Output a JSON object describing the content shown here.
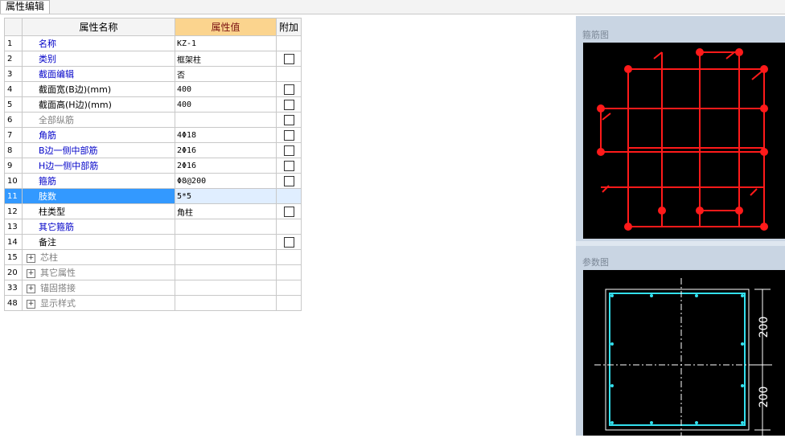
{
  "tab": {
    "label": "属性编辑"
  },
  "grid": {
    "headers": {
      "name": "属性名称",
      "value": "属性值",
      "extra": "附加"
    },
    "rows": [
      {
        "num": "1",
        "name": "名称",
        "value": "KZ-1",
        "color": "blue",
        "checkbox": false,
        "expand": false
      },
      {
        "num": "2",
        "name": "类别",
        "value": "框架柱",
        "color": "blue",
        "checkbox": true,
        "expand": false
      },
      {
        "num": "3",
        "name": "截面编辑",
        "value": "否",
        "color": "blue",
        "checkbox": false,
        "expand": false
      },
      {
        "num": "4",
        "name": "截面宽(B边)(mm)",
        "value": "400",
        "color": "black",
        "checkbox": true,
        "expand": false
      },
      {
        "num": "5",
        "name": "截面高(H边)(mm)",
        "value": "400",
        "color": "black",
        "checkbox": true,
        "expand": false
      },
      {
        "num": "6",
        "name": "全部纵筋",
        "value": "",
        "color": "gray",
        "checkbox": true,
        "expand": false
      },
      {
        "num": "7",
        "name": "角筋",
        "value": "4Φ18",
        "color": "blue",
        "checkbox": true,
        "expand": false
      },
      {
        "num": "8",
        "name": "B边一侧中部筋",
        "value": "2Φ16",
        "color": "blue",
        "checkbox": true,
        "expand": false
      },
      {
        "num": "9",
        "name": "H边一侧中部筋",
        "value": "2Φ16",
        "color": "blue",
        "checkbox": true,
        "expand": false
      },
      {
        "num": "10",
        "name": "箍筋",
        "value": "Φ8@200",
        "color": "blue",
        "checkbox": true,
        "expand": false
      },
      {
        "num": "11",
        "name": "肢数",
        "value": "5*5",
        "color": "blue",
        "checkbox": false,
        "expand": false,
        "selected": true
      },
      {
        "num": "12",
        "name": "柱类型",
        "value": "角柱",
        "color": "black",
        "checkbox": true,
        "expand": false
      },
      {
        "num": "13",
        "name": "其它箍筋",
        "value": "",
        "color": "blue",
        "checkbox": false,
        "expand": false
      },
      {
        "num": "14",
        "name": "备注",
        "value": "",
        "color": "black",
        "checkbox": true,
        "expand": false
      },
      {
        "num": "15",
        "name": "芯柱",
        "value": "",
        "color": "gray",
        "checkbox": false,
        "expand": true
      },
      {
        "num": "20",
        "name": "其它属性",
        "value": "",
        "color": "gray",
        "checkbox": false,
        "expand": true
      },
      {
        "num": "33",
        "name": "锚固搭接",
        "value": "",
        "color": "gray",
        "checkbox": false,
        "expand": true
      },
      {
        "num": "48",
        "name": "显示样式",
        "value": "",
        "color": "gray",
        "checkbox": false,
        "expand": true
      }
    ]
  },
  "rebar_panel": {
    "title": "箍筋图"
  },
  "param_panel": {
    "title": "参数图",
    "dim_top": "200",
    "dim_bottom": "200"
  },
  "colors": {
    "rebar": "#ff1a1a",
    "section": "#33e0ee",
    "header_highlight": "#fbd48e",
    "selection": "#3399ff"
  }
}
